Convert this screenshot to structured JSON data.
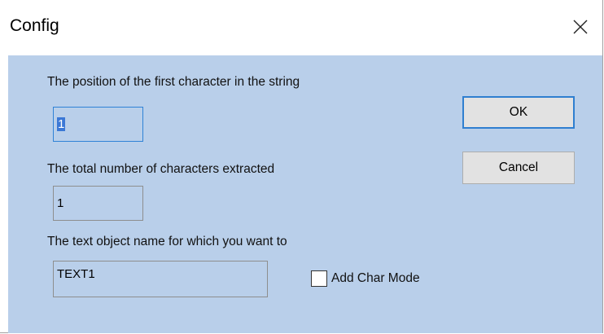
{
  "window": {
    "title": "Config"
  },
  "titlebar": {
    "close_icon": "close-icon"
  },
  "form": {
    "position_label": "The position of the first character in the string",
    "position_value": "1",
    "count_label": "The total number of characters extracted",
    "count_value": "1",
    "object_label": "The text object name for which you want to",
    "object_value": "TEXT1",
    "add_char_mode_label": "Add Char Mode",
    "add_char_mode_checked": false
  },
  "buttons": {
    "ok_label": "OK",
    "cancel_label": "Cancel"
  },
  "colors": {
    "client_background": "#b9cfea",
    "focus_border": "#2f82d6",
    "selection": "#3b78d6"
  }
}
